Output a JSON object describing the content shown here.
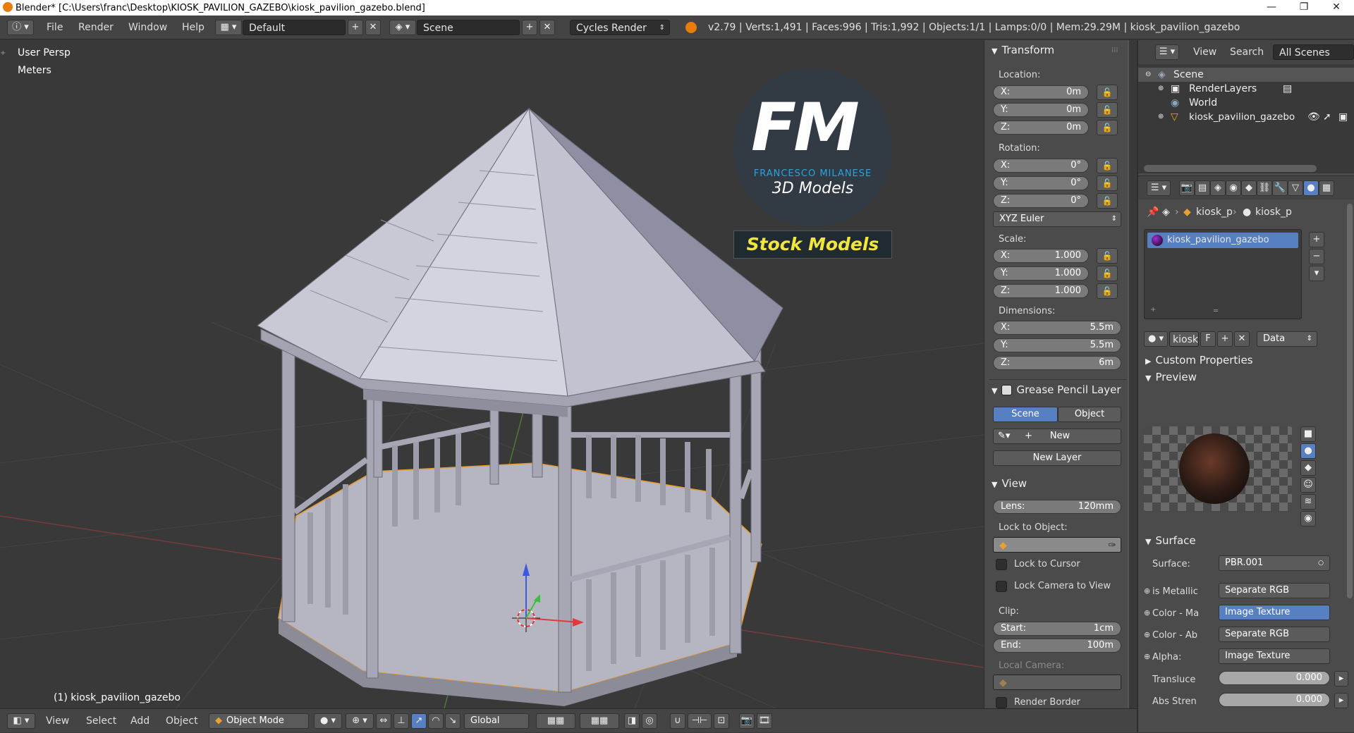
{
  "window": {
    "title": "Blender* [C:\\Users\\franc\\Desktop\\KIOSK_PAVILION_GAZEBO\\kiosk_pavilion_gazebo.blend]",
    "minimize": "—",
    "maximize": "❐",
    "close": "✕"
  },
  "topbar": {
    "menus": [
      "File",
      "Render",
      "Window",
      "Help"
    ],
    "layout": "Default",
    "scene": "Scene",
    "engine": "Cycles Render",
    "stats": "v2.79 | Verts:1,491 | Faces:996 | Tris:1,992 | Objects:1/1 | Lamps:0/0 | Mem:29.29M | kiosk_pavilion_gazebo"
  },
  "viewport": {
    "persp": "User Persp",
    "units": "Meters",
    "object_label": "(1) kiosk_pavilion_gazebo",
    "watermark": {
      "fm": "FM",
      "name": "FRANCESCO MILANESE",
      "sub": "3D Models",
      "stock": "Stock Models"
    }
  },
  "npanel": {
    "transform_header": "Transform",
    "location_label": "Location:",
    "location": {
      "x": "0m",
      "y": "0m",
      "z": "0m"
    },
    "rotation_label": "Rotation:",
    "rotation": {
      "x": "0°",
      "y": "0°",
      "z": "0°"
    },
    "rotation_mode": "XYZ Euler",
    "scale_label": "Scale:",
    "scale": {
      "x": "1.000",
      "y": "1.000",
      "z": "1.000"
    },
    "dimensions_label": "Dimensions:",
    "dimensions": {
      "x": "5.5m",
      "y": "5.5m",
      "z": "6m"
    },
    "axis": {
      "x": "X:",
      "y": "Y:",
      "z": "Z:"
    },
    "grease_header": "Grease Pencil Layer",
    "gp_scene": "Scene",
    "gp_object": "Object",
    "gp_new": "New",
    "gp_new_layer": "New Layer",
    "view_header": "View",
    "lens_label": "Lens:",
    "lens": "120mm",
    "lock_object_label": "Lock to Object:",
    "lock_cursor": "Lock to Cursor",
    "lock_camera": "Lock Camera to View",
    "clip_label": "Clip:",
    "clip_start_label": "Start:",
    "clip_start": "1cm",
    "clip_end_label": "End:",
    "clip_end": "100m",
    "local_camera": "Local Camera:",
    "render_border": "Render Border"
  },
  "outliner": {
    "view": "View",
    "search": "Search",
    "filter": "All Scenes",
    "items": [
      "Scene",
      "RenderLayers",
      "World",
      "kiosk_pavilion_gazebo"
    ]
  },
  "properties": {
    "crumb1": "kiosk_p",
    "crumb2": "kiosk_p",
    "material_slot": "kiosk_pavilion_gazebo",
    "mat_name": "kiosk",
    "mat_f": "F",
    "mat_link": "Data",
    "custom_props": "Custom Properties",
    "preview": "Preview",
    "surface_header": "Surface",
    "surface_label": "Surface:",
    "surface_value": "PBR.001",
    "inputs": [
      {
        "label": "is Metallic",
        "value": "Separate RGB"
      },
      {
        "label": "Color - Ma",
        "value": "Image Texture"
      },
      {
        "label": "Color - Ab",
        "value": "Separate RGB"
      },
      {
        "label": "Alpha:",
        "value": "Image Texture"
      }
    ],
    "translucent_label": "Transluce",
    "translucent_value": "0.000",
    "abs_label": "Abs Stren",
    "abs_value": "0.000"
  },
  "bottombar": {
    "menus": [
      "View",
      "Select",
      "Add",
      "Object"
    ],
    "mode": "Object Mode",
    "orientation": "Global"
  },
  "colors": {
    "accent_blue": "#5680c2",
    "header": "#444444",
    "panel": "#4b4b4b",
    "viewport": "#393939",
    "stock_yellow": "#f2e53d"
  }
}
